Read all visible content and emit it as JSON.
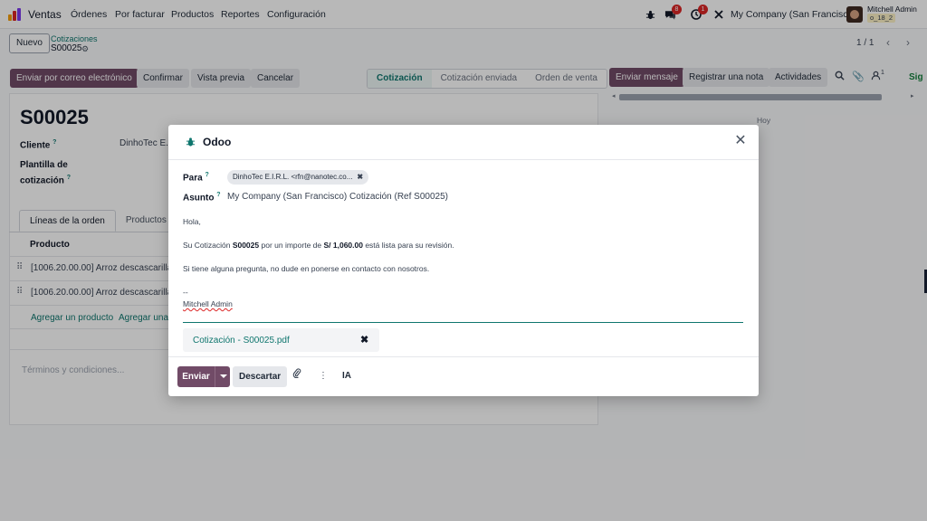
{
  "topnav": {
    "app_name": "Ventas",
    "menu": [
      "Órdenes",
      "Por facturar",
      "Productos",
      "Reportes",
      "Configuración"
    ],
    "chat_badge": "8",
    "activity_badge": "1",
    "company": "My Company (San Francisco)",
    "user_name": "Mitchell Admin",
    "database": "o_18_2"
  },
  "control_panel": {
    "new_button": "Nuevo",
    "breadcrumb_parent": "Cotizaciones",
    "breadcrumb_current": "S00025",
    "pager": "1 / 1"
  },
  "statusbar": {
    "buttons": [
      "Enviar por correo electrónico",
      "Confirmar",
      "Vista previa",
      "Cancelar"
    ],
    "stages": [
      "Cotización",
      "Cotización enviada",
      "Orden de venta"
    ],
    "active_stage": 0
  },
  "form": {
    "name": "S00025",
    "customer_label": "Cliente",
    "customer_value": "DinhoTec E.I.",
    "template_label_1": "Plantilla de",
    "template_label_2": "cotización",
    "help_mark": "?",
    "tabs": [
      "Líneas de la orden",
      "Productos op"
    ],
    "column_product": "Producto",
    "lines": [
      "[1006.20.00.00] Arroz descascarillado",
      "[1006.20.00.00] Arroz descascarillado"
    ],
    "add_product": "Agregar un producto",
    "add_section": "Agregar una",
    "terms_placeholder": "Términos y condiciones..."
  },
  "chatter": {
    "send_message": "Enviar mensaje",
    "log_note": "Registrar una nota",
    "activities": "Actividades",
    "followers_count": "1",
    "follow": "Sig",
    "today": "Hoy"
  },
  "modal": {
    "title": "Odoo",
    "to_label": "Para",
    "recipient": "DinhoTec E.I.R.L. <rfn@nanotec.co...",
    "subject_label": "Asunto",
    "subject_value": "My Company (San Francisco) Cotización (Ref S00025)",
    "greeting": "Hola,",
    "line1_pre": "Su Cotización ",
    "line1_ref": "S00025",
    "line1_mid": " por un importe de ",
    "line1_amount": "S/ 1,060.00",
    "line1_post": " está lista para su revisión.",
    "line2": "Si tiene alguna pregunta, no dude en ponerse en contacto con nosotros.",
    "sig_sep": "--",
    "sig_name": "Mitchell Admin",
    "attachment": "Cotización - S00025.pdf",
    "send_button": "Enviar",
    "discard_button": "Descartar",
    "ai_button": "IA"
  },
  "colors": {
    "primary": "#714b67",
    "link": "#0f766e",
    "badge": "#dc2626"
  }
}
